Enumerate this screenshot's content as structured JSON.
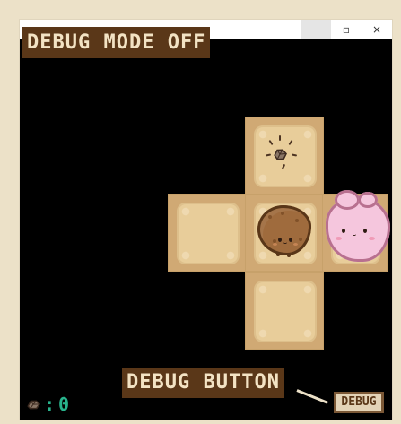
{
  "window": {
    "controls": {
      "minimize": "–",
      "maximize": "▫",
      "close": "×"
    }
  },
  "overlay": {
    "debug_mode_label": "DEBUG MODE OFF",
    "debug_button_label": "DEBUG BUTTON"
  },
  "hud": {
    "collectible_icon": "rock-icon",
    "count_separator": ":",
    "count": "0"
  },
  "controls": {
    "debug_button": "DEBUG"
  },
  "colors": {
    "label_background": "#5a3718",
    "label_text": "#f3e3c4",
    "counter_text": "#28b38c",
    "tile_outer": "#d0a974",
    "tile_inner": "#e8cd9a",
    "player_fill": "#9f6b3d",
    "blob_fill": "#f5c6dd"
  }
}
